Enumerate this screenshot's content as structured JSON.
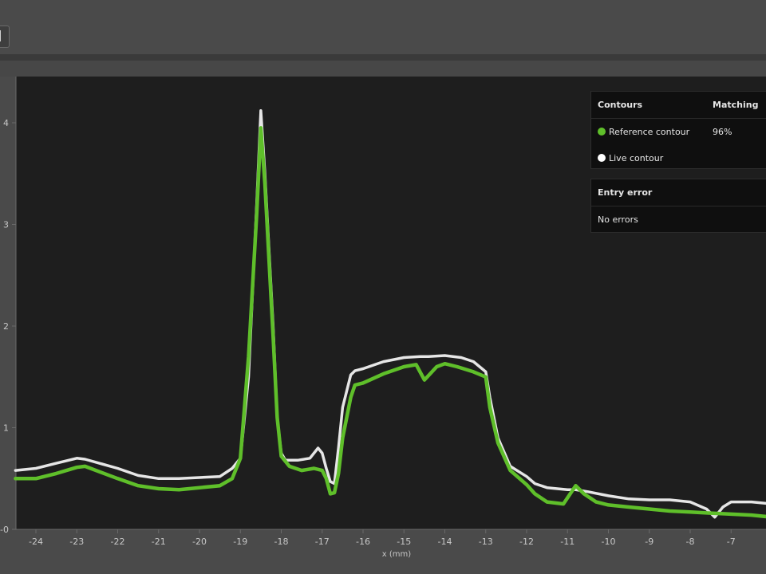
{
  "panel": {
    "contours_header": "Contours",
    "matching_header": "Matching",
    "reference_label": "Reference contour",
    "reference_match": "96%",
    "live_label": "Live contour",
    "entry_error_header": "Entry error",
    "entry_error_value": "No errors"
  },
  "colors": {
    "reference": "#5fbf2a",
    "live": "#e6e6e6",
    "plot_bg": "#1e1e1e",
    "panel_bg": "#0f0f0f"
  },
  "icons": {
    "toolbar_button": "panel-toggle-icon",
    "reference_marker": "green-dot-icon",
    "live_marker": "white-dot-icon"
  },
  "chart_data": {
    "type": "line",
    "xlabel": "x (mm)",
    "ylabel": "",
    "xlim": [
      -24.5,
      -6
    ],
    "ylim": [
      0,
      4.2
    ],
    "xticks": [
      -24,
      -23,
      -22,
      -21,
      -20,
      -19,
      -18,
      -17,
      -16,
      -15,
      -14,
      -13,
      -12,
      -11,
      -10,
      -9,
      -8,
      -7
    ],
    "yticks": [
      0,
      1,
      2,
      3,
      4
    ],
    "ytick_labels": [
      "-0",
      "1",
      "2",
      "3",
      "4"
    ],
    "grid": false,
    "legend": "top-right",
    "series": [
      {
        "name": "Live contour",
        "color": "#e6e6e6",
        "x": [
          -24.5,
          -24,
          -23.5,
          -23,
          -22.8,
          -22,
          -21.5,
          -21,
          -20.5,
          -20,
          -19.5,
          -19.2,
          -19,
          -18.8,
          -18.6,
          -18.5,
          -18.4,
          -18.2,
          -18.1,
          -18,
          -17.9,
          -17.6,
          -17.3,
          -17.1,
          -17,
          -16.9,
          -16.8,
          -16.7,
          -16.6,
          -16.5,
          -16.3,
          -16.2,
          -16,
          -15.5,
          -15,
          -14.6,
          -14.4,
          -14,
          -13.6,
          -13.3,
          -13,
          -12.9,
          -12.7,
          -12.4,
          -12,
          -11.8,
          -11.5,
          -11,
          -10.8,
          -10.5,
          -10,
          -9.5,
          -9,
          -8.5,
          -8,
          -7.6,
          -7.4,
          -7.2,
          -7,
          -6.5,
          -6
        ],
        "y": [
          0.58,
          0.6,
          0.65,
          0.7,
          0.69,
          0.6,
          0.53,
          0.5,
          0.5,
          0.51,
          0.52,
          0.6,
          0.7,
          1.5,
          3.2,
          4.12,
          3.5,
          2.0,
          1.1,
          0.75,
          0.68,
          0.68,
          0.7,
          0.8,
          0.75,
          0.6,
          0.47,
          0.45,
          0.8,
          1.2,
          1.52,
          1.56,
          1.58,
          1.65,
          1.69,
          1.7,
          1.7,
          1.71,
          1.69,
          1.65,
          1.55,
          1.3,
          0.9,
          0.62,
          0.52,
          0.45,
          0.41,
          0.39,
          0.39,
          0.37,
          0.33,
          0.3,
          0.29,
          0.29,
          0.27,
          0.2,
          0.12,
          0.22,
          0.27,
          0.27,
          0.25
        ]
      },
      {
        "name": "Reference contour",
        "color": "#5fbf2a",
        "x": [
          -24.5,
          -24,
          -23.5,
          -23,
          -22.8,
          -22,
          -21.5,
          -21,
          -20.5,
          -20,
          -19.5,
          -19.2,
          -19,
          -18.8,
          -18.6,
          -18.5,
          -18.4,
          -18.2,
          -18.1,
          -18,
          -17.8,
          -17.5,
          -17.2,
          -17,
          -16.9,
          -16.8,
          -16.7,
          -16.6,
          -16.5,
          -16.3,
          -16.2,
          -16,
          -15.5,
          -15,
          -14.7,
          -14.5,
          -14.2,
          -14,
          -13.7,
          -13.3,
          -13,
          -12.9,
          -12.7,
          -12.4,
          -12,
          -11.8,
          -11.5,
          -11.1,
          -10.9,
          -10.8,
          -10.6,
          -10.3,
          -10,
          -9.5,
          -9,
          -8.5,
          -8,
          -7.5,
          -7,
          -6.5,
          -6
        ],
        "y": [
          0.5,
          0.5,
          0.55,
          0.61,
          0.62,
          0.5,
          0.43,
          0.4,
          0.39,
          0.41,
          0.43,
          0.5,
          0.7,
          1.7,
          3.1,
          3.95,
          3.4,
          1.9,
          1.1,
          0.72,
          0.62,
          0.58,
          0.6,
          0.58,
          0.5,
          0.35,
          0.36,
          0.55,
          0.9,
          1.3,
          1.42,
          1.44,
          1.53,
          1.6,
          1.62,
          1.47,
          1.6,
          1.63,
          1.6,
          1.55,
          1.5,
          1.2,
          0.85,
          0.58,
          0.44,
          0.35,
          0.27,
          0.25,
          0.37,
          0.43,
          0.35,
          0.27,
          0.24,
          0.22,
          0.2,
          0.18,
          0.17,
          0.16,
          0.15,
          0.14,
          0.12
        ]
      }
    ]
  }
}
